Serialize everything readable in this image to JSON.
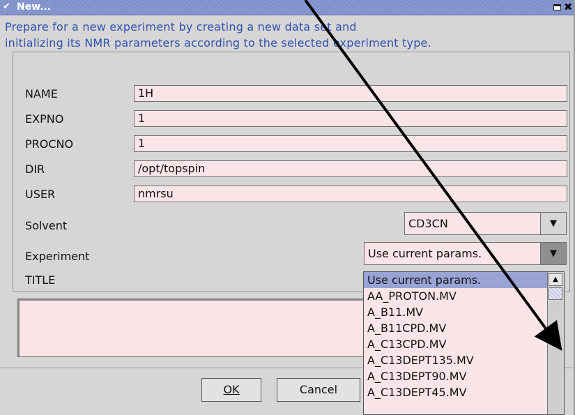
{
  "window": {
    "title": "New..."
  },
  "description": {
    "line1": "Prepare for a new experiment by creating a new data set and",
    "line2": "initializing its NMR parameters according to the selected experiment type."
  },
  "fields": [
    {
      "label": "NAME",
      "value": "1H"
    },
    {
      "label": "EXPNO",
      "value": "1"
    },
    {
      "label": "PROCNO",
      "value": "1"
    },
    {
      "label": "DIR",
      "value": "/opt/topspin"
    },
    {
      "label": "USER",
      "value": "nmrsu"
    }
  ],
  "solvent": {
    "label": "Solvent",
    "value": "CD3CN"
  },
  "experiment": {
    "label": "Experiment",
    "value": "Use current params."
  },
  "title_field": {
    "label": "TITLE",
    "value": ""
  },
  "experiment_options": [
    "Use current params.",
    "AA_PROTON.MV",
    "A_B11.MV",
    "A_B11CPD.MV",
    "A_C13CPD.MV",
    "A_C13DEPT135.MV",
    "A_C13DEPT90.MV",
    "A_C13DEPT45.MV"
  ],
  "buttons": {
    "ok": "OK",
    "cancel": "Cancel"
  },
  "colors": {
    "field_bg": "#f9e4e8",
    "title_bar": "#8b9bd2",
    "description_text": "#3050b0"
  },
  "icons": {
    "window_menu": "chevron-down-icon",
    "maximize": "maximize-icon",
    "close": "close-icon",
    "dropdown": "triangle-down-icon"
  }
}
